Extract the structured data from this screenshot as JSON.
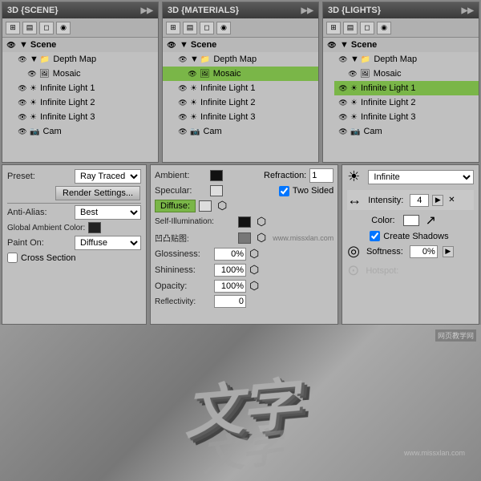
{
  "panels": {
    "scene": {
      "title": "3D {SCENE}",
      "toolbar_icons": [
        "grid",
        "layers",
        "shape",
        "eye"
      ],
      "tree": {
        "root": "Scene",
        "items": [
          {
            "label": "Depth Map",
            "indent": 1,
            "icon": "folder",
            "expanded": true
          },
          {
            "label": "Mosaic",
            "indent": 2,
            "icon": "image"
          },
          {
            "label": "Infinite Light 1",
            "indent": 1,
            "icon": "light"
          },
          {
            "label": "Infinite Light 2",
            "indent": 1,
            "icon": "light"
          },
          {
            "label": "Infinite Light 3",
            "indent": 1,
            "icon": "light"
          },
          {
            "label": "Cam",
            "indent": 1,
            "icon": "camera"
          }
        ]
      }
    },
    "materials": {
      "title": "3D {MATERIALS}",
      "tree": {
        "root": "Scene",
        "items": [
          {
            "label": "Depth Map",
            "indent": 1,
            "icon": "folder",
            "expanded": true
          },
          {
            "label": "Mosaic",
            "indent": 2,
            "icon": "image",
            "selected": true
          },
          {
            "label": "Infinite Light 1",
            "indent": 1,
            "icon": "light"
          },
          {
            "label": "Infinite Light 2",
            "indent": 1,
            "icon": "light"
          },
          {
            "label": "Infinite Light 3",
            "indent": 1,
            "icon": "light"
          },
          {
            "label": "Cam",
            "indent": 1,
            "icon": "camera"
          }
        ]
      }
    },
    "lights": {
      "title": "3D {LIGHTS}",
      "tree": {
        "root": "Scene",
        "items": [
          {
            "label": "Depth Map",
            "indent": 1,
            "icon": "folder",
            "expanded": true
          },
          {
            "label": "Mosaic",
            "indent": 2,
            "icon": "image"
          },
          {
            "label": "Infinite Light 1",
            "indent": 1,
            "icon": "light",
            "selected": true
          },
          {
            "label": "Infinite Light 2",
            "indent": 1,
            "icon": "light"
          },
          {
            "label": "Infinite Light 3",
            "indent": 1,
            "icon": "light"
          },
          {
            "label": "Cam",
            "indent": 1,
            "icon": "camera"
          }
        ]
      }
    }
  },
  "bottom": {
    "scene_panel": {
      "preset_label": "Preset:",
      "preset_value": "Ray Traced",
      "render_btn": "Render Settings...",
      "antialias_label": "Anti-Alias:",
      "antialias_value": "Best",
      "ambient_label": "Global Ambient Color:",
      "paint_on_label": "Paint On:",
      "paint_on_value": "Diffuse",
      "cross_section_label": "Cross Section"
    },
    "materials_panel": {
      "ambient_label": "Ambient:",
      "refraction_label": "Refraction:",
      "refraction_value": "1",
      "specular_label": "Specular:",
      "two_sided_label": "Two Sided",
      "diffuse_label": "Diffuse:",
      "self_illum_label": "Self-Illumination:",
      "bump_label": "凹凸贴图:",
      "glossiness_label": "Glossiness:",
      "glossiness_value": "0%",
      "shininess_label": "Shininess:",
      "shininess_value": "100%",
      "opacity_label": "Opacity:",
      "opacity_value": "100%",
      "reflectivity_label": "Reflectivity:",
      "reflectivity_value": "0"
    },
    "lights_panel": {
      "type_label": "Infinite",
      "intensity_label": "Intensity:",
      "intensity_value": "4",
      "color_label": "Color:",
      "create_shadows_label": "Create Shadows",
      "softness_label": "Softness:",
      "softness_value": "0%",
      "hotspot_label": "Hotspot:"
    }
  },
  "render": {
    "text": "文字",
    "watermark1": "网页教学网",
    "watermark2": "www.missxlan.com"
  },
  "colors": {
    "green_selected": "#7ab648",
    "panel_bg": "#c0c0c0",
    "header_dark": "#3a3a3a",
    "header_mid": "#5a5a5a"
  }
}
